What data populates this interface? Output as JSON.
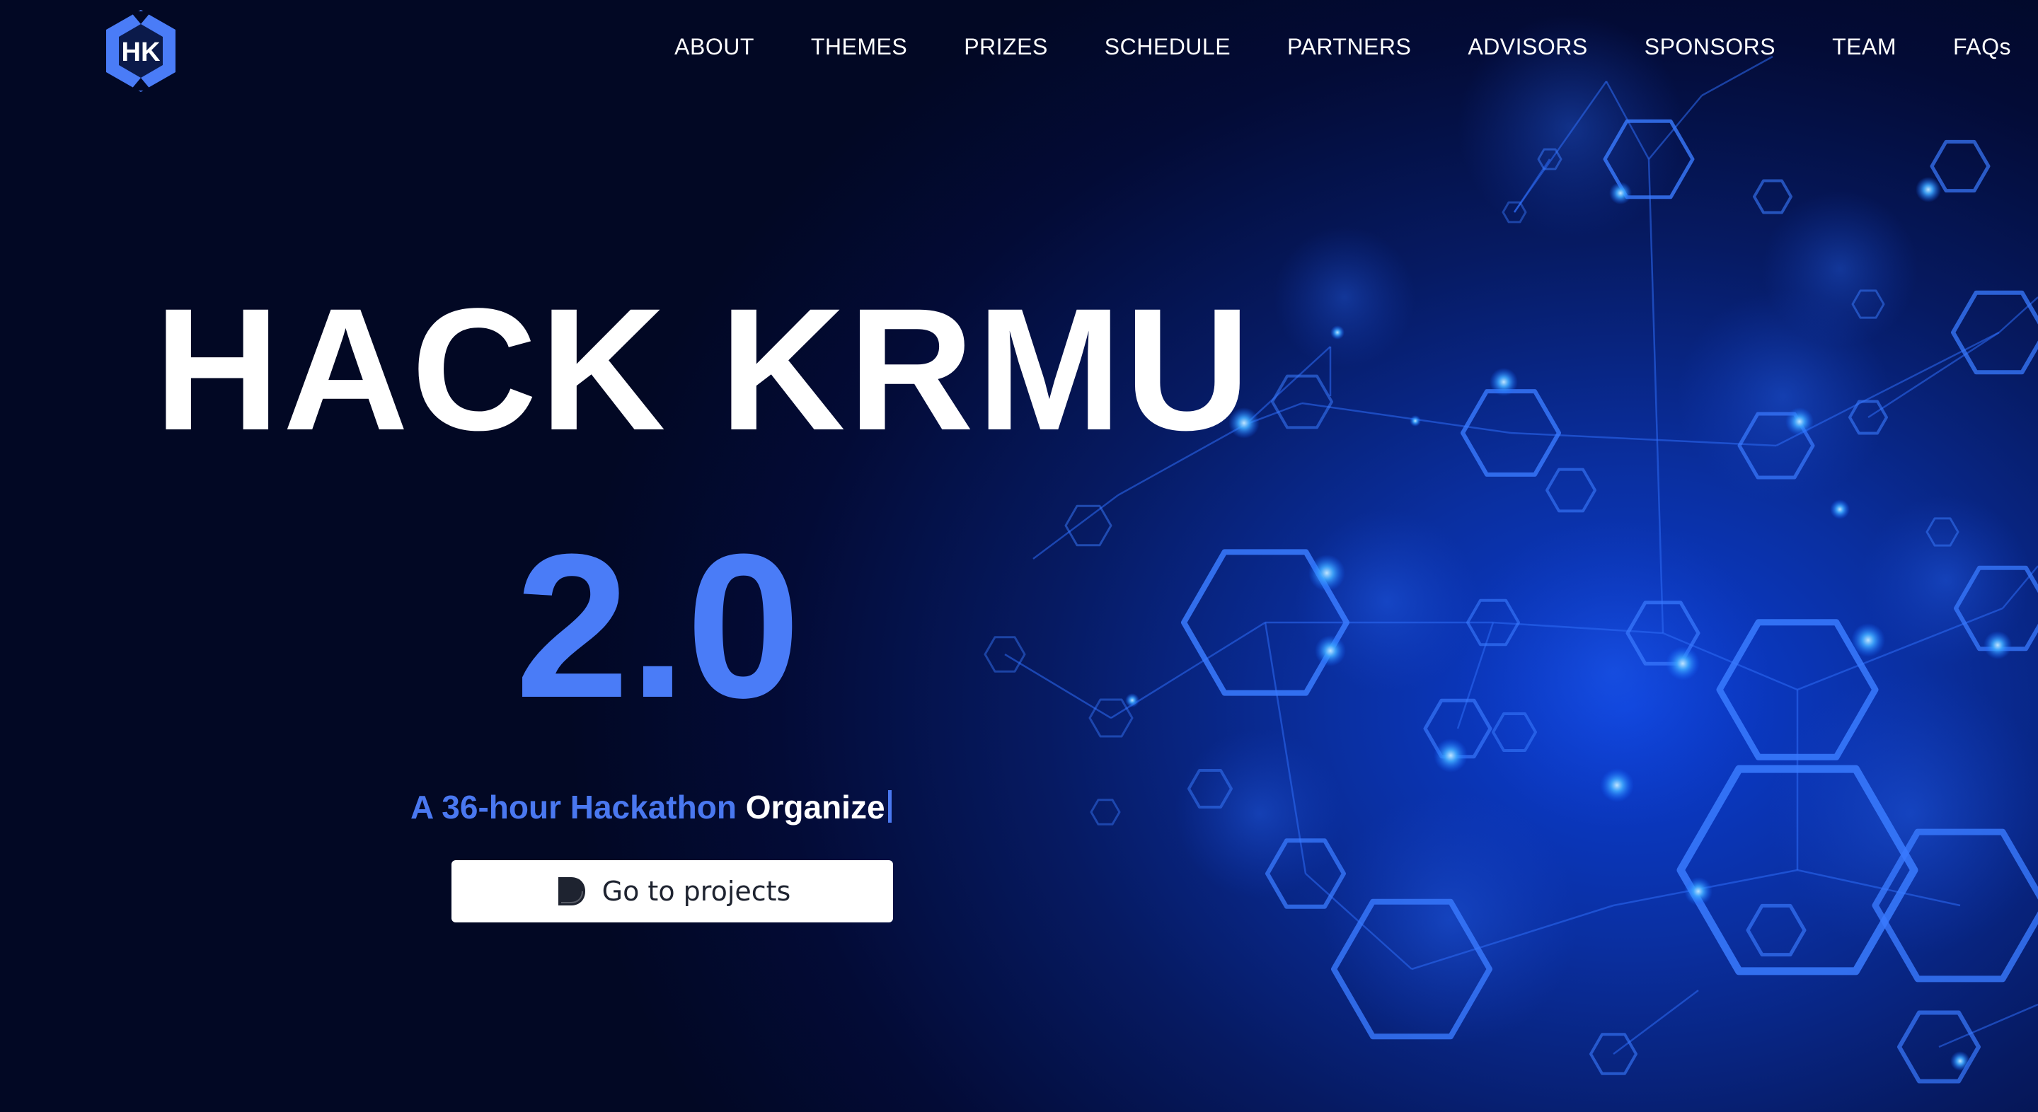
{
  "logo": {
    "text": "HK",
    "icon": "hexagon-logo-icon"
  },
  "nav": {
    "items": [
      {
        "label": "ABOUT"
      },
      {
        "label": "THEMES"
      },
      {
        "label": "PRIZES"
      },
      {
        "label": "SCHEDULE"
      },
      {
        "label": "PARTNERS"
      },
      {
        "label": "ADVISORS"
      },
      {
        "label": "SPONSORS"
      },
      {
        "label": "TEAM"
      },
      {
        "label": "FAQs"
      }
    ]
  },
  "hero": {
    "title": "HACK KRMU",
    "version": "2.0",
    "tagline_accent": "A 36-hour Hackathon",
    "tagline_typed": "Organize",
    "cta_label": "Go to projects",
    "cta_icon": "devpost-icon"
  },
  "colors": {
    "accent": "#4a7cf7",
    "background": "#020824",
    "glow": "#0b3ed6"
  }
}
